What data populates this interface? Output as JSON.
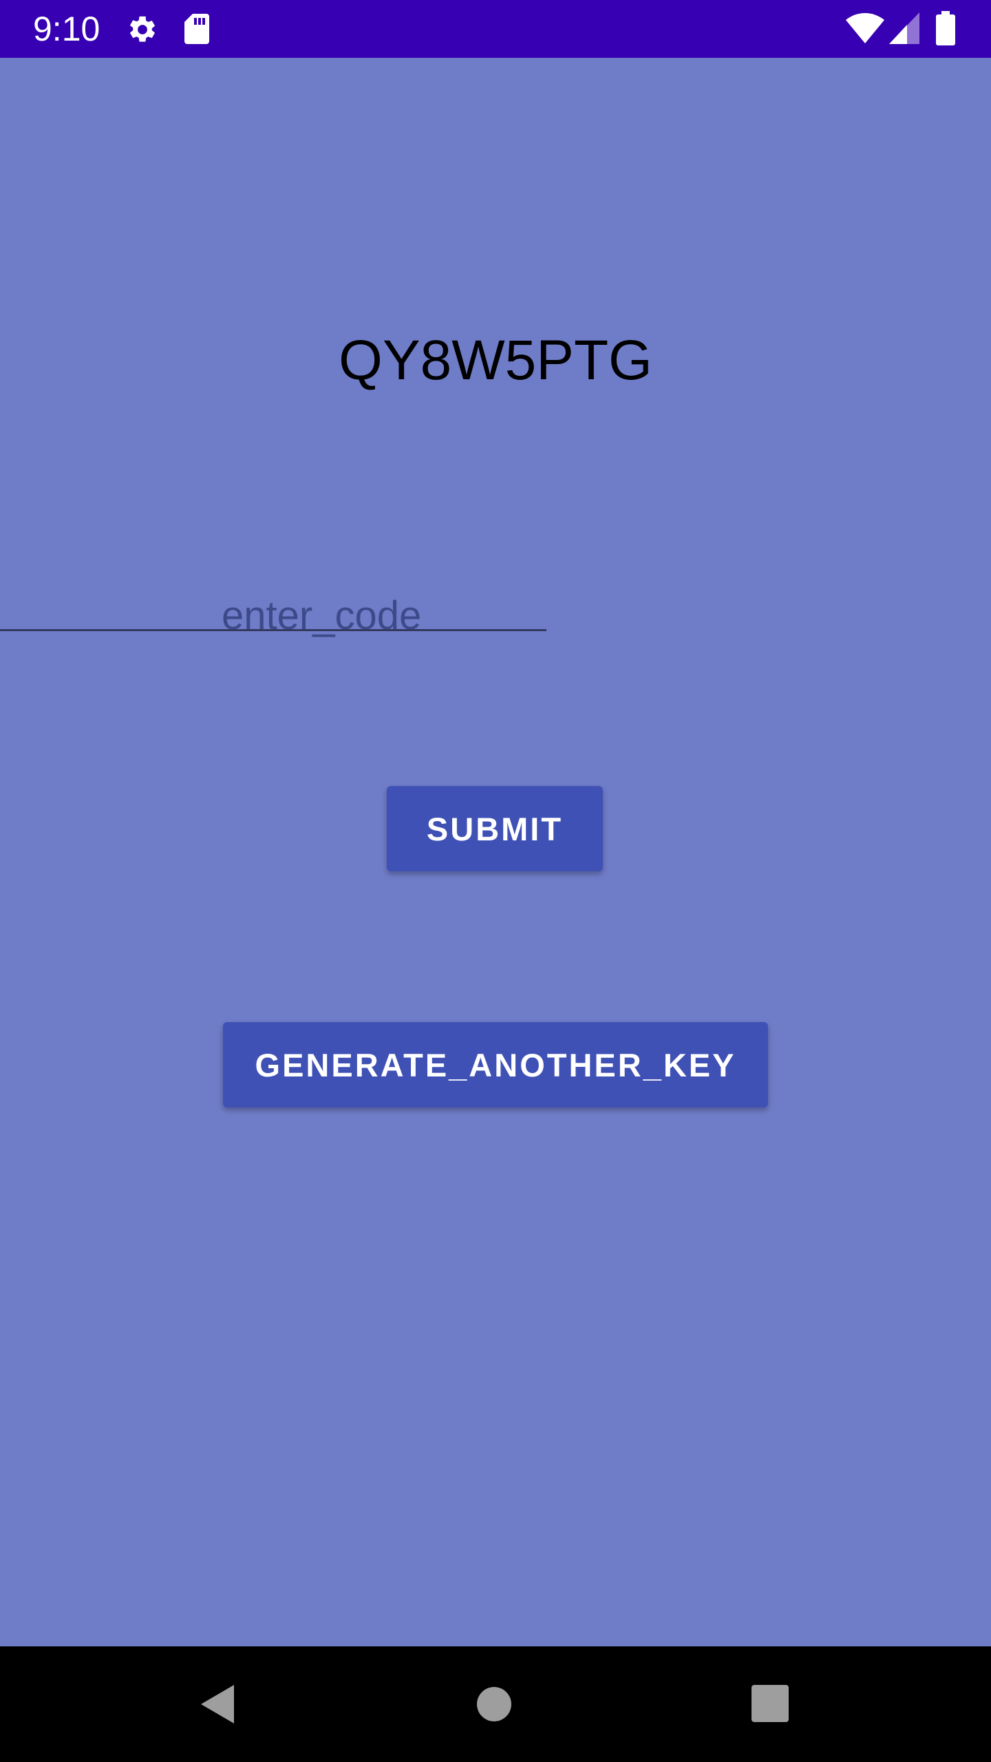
{
  "status_bar": {
    "time": "9:10",
    "icons": [
      "gear-icon",
      "sd-card-icon",
      "wifi-icon",
      "signal-icon",
      "battery-icon"
    ],
    "background": "#3700b3"
  },
  "main": {
    "key_text": "QY8W5PTG",
    "code_input": {
      "placeholder": "enter_code",
      "value": ""
    },
    "submit_label": "SUBMIT",
    "generate_label": "GENERATE_ANOTHER_KEY",
    "background": "#6f7cc8",
    "button_color": "#3f51b5"
  },
  "nav_bar": {
    "icons": [
      "back-icon",
      "home-icon",
      "recents-icon"
    ]
  }
}
